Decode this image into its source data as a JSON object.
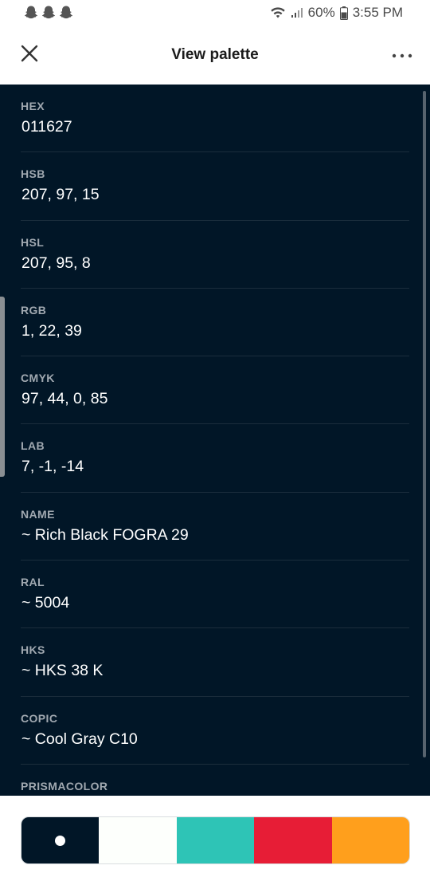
{
  "status_bar": {
    "battery_text": "60%",
    "time": "3:55 PM",
    "left_icons": [
      "snapchat-icon",
      "snapchat-icon",
      "snapchat-icon"
    ],
    "right_icons": [
      "wifi-icon",
      "signal-icon",
      "battery-icon"
    ]
  },
  "header": {
    "title": "View palette",
    "close_icon": "close-icon",
    "more_icon": "more-icon"
  },
  "details": [
    {
      "label": "HEX",
      "value": "011627"
    },
    {
      "label": "HSB",
      "value": "207, 97, 15"
    },
    {
      "label": "HSL",
      "value": "207, 95, 8"
    },
    {
      "label": "RGB",
      "value": "1, 22, 39"
    },
    {
      "label": "CMYK",
      "value": "97, 44, 0, 85"
    },
    {
      "label": "LAB",
      "value": "7, -1, -14"
    },
    {
      "label": "NAME",
      "value": "~ Rich Black FOGRA 29"
    },
    {
      "label": "RAL",
      "value": "~ 5004"
    },
    {
      "label": "HKS",
      "value": "~ HKS 38 K"
    },
    {
      "label": "COPIC",
      "value": "~ Cool Gray C10"
    },
    {
      "label": "PRISMACOLOR",
      "value": ""
    }
  ],
  "palette": {
    "swatches": [
      "#011627",
      "#fdfffc",
      "#2ec4b6",
      "#e71d36",
      "#ff9f1c"
    ],
    "selected_index": 0
  },
  "colors": {
    "content_background": "#011627",
    "label_color": "#a1a9b1",
    "value_color": "#ffffff"
  }
}
